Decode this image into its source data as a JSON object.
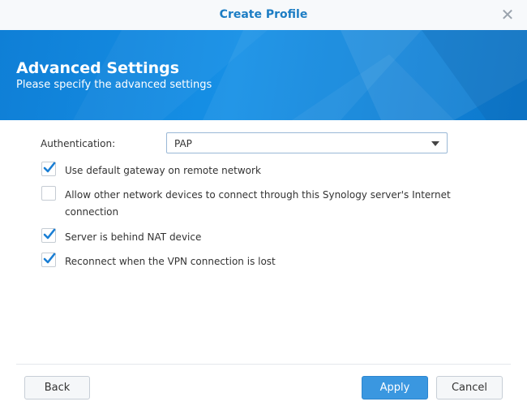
{
  "dialog": {
    "title": "Create Profile"
  },
  "banner": {
    "title": "Advanced Settings",
    "subtitle": "Please specify the advanced settings"
  },
  "form": {
    "authentication": {
      "label": "Authentication:",
      "value": "PAP"
    },
    "options": [
      {
        "label": "Use default gateway on remote network",
        "checked": true
      },
      {
        "label": "Allow other network devices to connect through this Synology server's Internet connection",
        "checked": false
      },
      {
        "label": "Server is behind NAT device",
        "checked": true
      },
      {
        "label": "Reconnect when the VPN connection is lost",
        "checked": true
      }
    ]
  },
  "footer": {
    "back_label": "Back",
    "apply_label": "Apply",
    "cancel_label": "Cancel"
  },
  "colors": {
    "accent": "#1c7dc4",
    "banner": "#1690e6",
    "check": "#1a7ed4",
    "primary_button": "#3a97e0"
  },
  "icons": {
    "close": "close-icon",
    "dropdown": "chevron-down-icon",
    "checkmark": "checkmark-icon"
  }
}
